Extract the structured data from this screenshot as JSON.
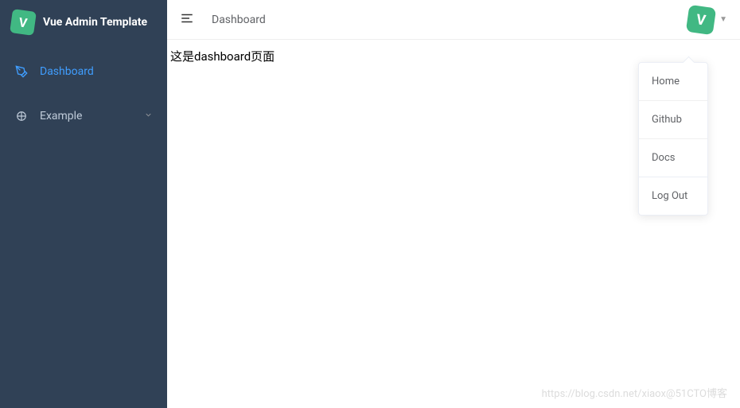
{
  "logo": {
    "letter": "V",
    "text": "Vue Admin Template"
  },
  "sidebar": {
    "items": [
      {
        "label": "Dashboard",
        "active": true
      },
      {
        "label": "Example",
        "active": false
      }
    ]
  },
  "navbar": {
    "breadcrumb": "Dashboard",
    "avatar_letter": "V"
  },
  "content": {
    "text": "这是dashboard页面"
  },
  "dropdown": {
    "items": [
      {
        "label": "Home"
      },
      {
        "label": "Github"
      },
      {
        "label": "Docs"
      },
      {
        "label": "Log Out"
      }
    ]
  },
  "watermark": "https://blog.csdn.net/xiaox@51CTO博客"
}
